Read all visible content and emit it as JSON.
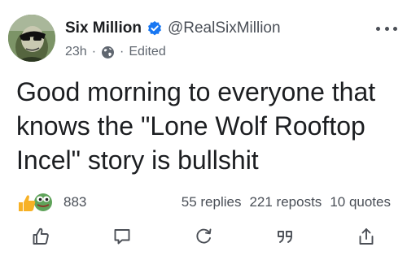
{
  "post": {
    "author": {
      "name": "Six Million",
      "handle": "@RealSixMillion",
      "verified": true
    },
    "meta": {
      "time": "23h",
      "visibility_icon": "globe-icon",
      "edited_label": "Edited"
    },
    "more_icon": "more-dots-icon",
    "text": "Good morning to everyone that knows the \"Lone Wolf Rooftop Incel\" story is bullshit",
    "reactions": {
      "icons": [
        "thumbs-up-reaction-icon",
        "frog-reaction-icon"
      ],
      "count": "883"
    },
    "stats": {
      "replies": "55 replies",
      "reposts": "221 reposts",
      "quotes": "10 quotes"
    },
    "actions": [
      "like-icon",
      "comment-icon",
      "repost-icon",
      "quote-icon",
      "share-icon"
    ]
  },
  "colors": {
    "verified_blue": "#1877F2",
    "text_primary": "#1c1e21",
    "text_secondary": "#606770",
    "icon_gray": "#4b4f56",
    "like_yellow": "#f7b125"
  }
}
